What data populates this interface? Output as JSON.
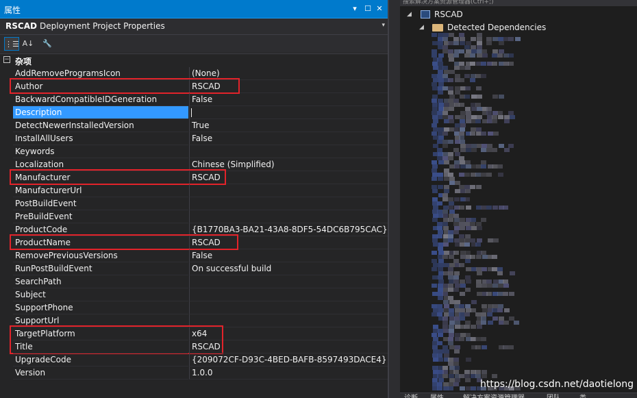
{
  "panel": {
    "title": "属性",
    "pin_glyph": "▾",
    "max_glyph": "☐",
    "close_glyph": "✕",
    "object_name": "RSCAD",
    "object_desc": "Deployment Project Properties",
    "dropdown_glyph": "▾"
  },
  "toolbar": {
    "categorized_glyph": "⋮☰",
    "alphabetical_glyph": "A↓",
    "property_pages_glyph": "🔧"
  },
  "category": {
    "toggle": "−",
    "label": "杂项"
  },
  "rows": [
    {
      "key": "AddRemoveProgramsIcon",
      "value": "(None)"
    },
    {
      "key": "Author",
      "value": "RSCAD"
    },
    {
      "key": "BackwardCompatibleIDGeneration",
      "value": "False"
    },
    {
      "key": "Description",
      "value": ""
    },
    {
      "key": "DetectNewerInstalledVersion",
      "value": "True"
    },
    {
      "key": "InstallAllUsers",
      "value": "False"
    },
    {
      "key": "Keywords",
      "value": ""
    },
    {
      "key": "Localization",
      "value": "Chinese (Simplified)"
    },
    {
      "key": "Manufacturer",
      "value": "RSCAD"
    },
    {
      "key": "ManufacturerUrl",
      "value": ""
    },
    {
      "key": "PostBuildEvent",
      "value": ""
    },
    {
      "key": "PreBuildEvent",
      "value": ""
    },
    {
      "key": "ProductCode",
      "value": "{B1770BA3-BA21-43A8-8DF5-54DC6B795CAC}"
    },
    {
      "key": "ProductName",
      "value": "RSCAD"
    },
    {
      "key": "RemovePreviousVersions",
      "value": "False"
    },
    {
      "key": "RunPostBuildEvent",
      "value": "On successful build"
    },
    {
      "key": "SearchPath",
      "value": ""
    },
    {
      "key": "Subject",
      "value": ""
    },
    {
      "key": "SupportPhone",
      "value": ""
    },
    {
      "key": "SupportUrl",
      "value": ""
    },
    {
      "key": "TargetPlatform",
      "value": "x64"
    },
    {
      "key": "Title",
      "value": "RSCAD"
    },
    {
      "key": "UpgradeCode",
      "value": "{209072CF-D93C-4BED-BAFB-8597493DACE4}"
    },
    {
      "key": "Version",
      "value": "1.0.0"
    }
  ],
  "selected_row": "Description",
  "highlighted_rows": [
    "Author",
    "Manufacturer",
    "ProductName",
    "TargetPlatform",
    "Title"
  ],
  "colors": {
    "title_bar": "#007acc",
    "selection": "#3399ff",
    "highlight_box": "#e3232a",
    "background": "#252526"
  },
  "solution": {
    "search_text": "搜索解决方案资源管理器(Ctrl+;)",
    "project_arrow": "◢",
    "project_name": "RSCAD",
    "deps_arrow": "◢",
    "deps_label": "Detected Dependencies",
    "folder_icon": "folder-icon",
    "project_icon": "setup-project-icon"
  },
  "bottom_tabs": [
    "诊断…",
    "属性",
    "解决方案资源管理器",
    "团队…",
    "类…"
  ],
  "watermark": "https://blog.csdn.net/daotielong"
}
